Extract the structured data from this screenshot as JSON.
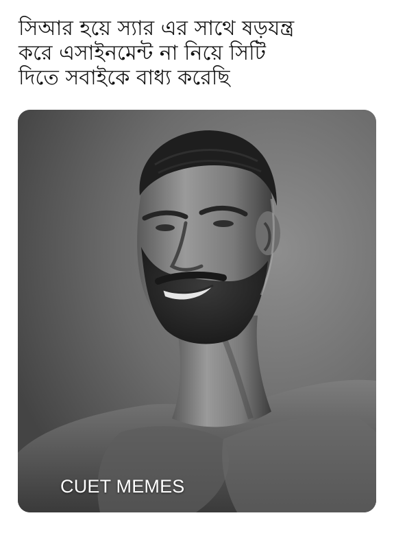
{
  "caption": {
    "lines": [
      "সিআর হয়ে স্যার এর সাথে ষড়যন্ত্র",
      "করে এসাইনমেন্ট না নিয়ে সিটি",
      "দিতে সবাইকে বাধ্য করেছি"
    ]
  },
  "photo": {
    "watermark": "CUET MEMES",
    "colors": {
      "background": "#6e6e6e",
      "skin_mid": "#8c8c8c",
      "skin_dark": "#3a3a3a",
      "beard": "#2a2a2a",
      "hair": "#1e1e1e"
    }
  }
}
